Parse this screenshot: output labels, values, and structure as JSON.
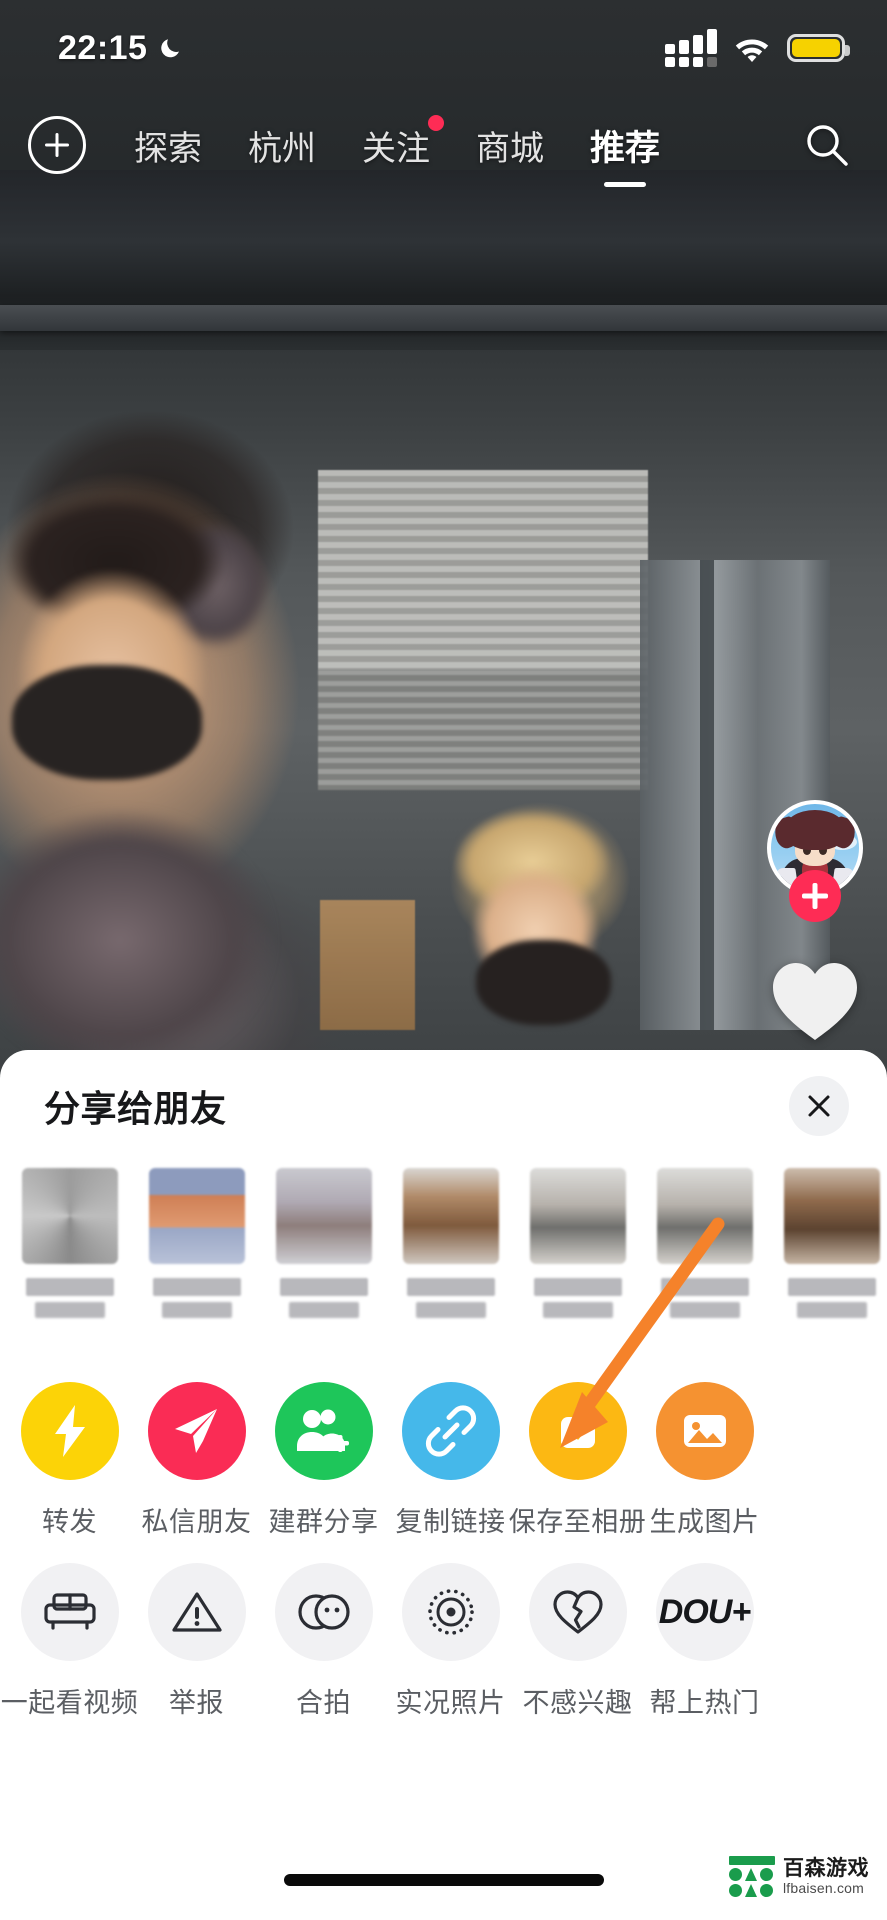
{
  "status_bar": {
    "time": "22:15",
    "moon_icon": "crescent-moon-icon",
    "signal_icon": "cellular-signal-icon",
    "wifi_icon": "wifi-icon",
    "battery_icon": "battery-icon",
    "battery_color": "#f6d200"
  },
  "top_nav": {
    "plus_icon": "plus-circle-icon",
    "search_icon": "search-icon",
    "tabs": [
      {
        "label": "探索",
        "active": false,
        "dot": false
      },
      {
        "label": "杭州",
        "active": false,
        "dot": false
      },
      {
        "label": "关注",
        "active": false,
        "dot": true
      },
      {
        "label": "商城",
        "active": false,
        "dot": false
      },
      {
        "label": "推荐",
        "active": true,
        "dot": false
      }
    ]
  },
  "right_rail": {
    "avatar_name": "user-avatar",
    "follow_label": "+",
    "like_icon": "heart-icon"
  },
  "share_sheet": {
    "title": "分享给朋友",
    "close_icon": "close-icon",
    "friends": [
      {
        "name": "",
        "censored": true
      },
      {
        "name": "",
        "censored": true
      },
      {
        "name": "",
        "censored": true
      },
      {
        "name": "",
        "censored": true
      },
      {
        "name": "",
        "censored": true
      },
      {
        "name": "",
        "censored": true
      },
      {
        "name": "",
        "censored": true
      }
    ],
    "actions_row1": [
      {
        "label": "转发",
        "icon": "lightning-bolt-icon",
        "color": "#fcd307",
        "style": "solid"
      },
      {
        "label": "私信朋友",
        "icon": "paper-plane-icon",
        "color": "#fa2c55",
        "style": "solid"
      },
      {
        "label": "建群分享",
        "icon": "add-group-icon",
        "color": "#1ec65a",
        "style": "solid"
      },
      {
        "label": "复制链接",
        "icon": "link-chain-icon",
        "color": "#45b8ea",
        "style": "solid"
      },
      {
        "label": "保存至相册",
        "icon": "download-album-icon",
        "color": "#fcb813",
        "style": "solid"
      },
      {
        "label": "生成图片",
        "icon": "image-picture-icon",
        "color": "#f59231",
        "style": "solid"
      }
    ],
    "actions_row2": [
      {
        "label": "一起看视频",
        "icon": "sofa-icon",
        "color": "#f1f1f3",
        "style": "grey"
      },
      {
        "label": "举报",
        "icon": "warning-triangle-icon",
        "color": "#f1f1f3",
        "style": "grey"
      },
      {
        "label": "合拍",
        "icon": "duet-circles-icon",
        "color": "#f1f1f3",
        "style": "grey"
      },
      {
        "label": "实况照片",
        "icon": "live-photo-icon",
        "color": "#f1f1f3",
        "style": "grey"
      },
      {
        "label": "不感兴趣",
        "icon": "broken-heart-icon",
        "color": "#f1f1f3",
        "style": "grey"
      },
      {
        "label": "帮上热门",
        "icon": "dou-plus-icon",
        "color": "#f1f1f3",
        "style": "grey",
        "icon_text": "DOU+"
      }
    ]
  },
  "annotation": {
    "arrow_icon": "orange-arrow-icon",
    "arrow_color": "#f5822a"
  },
  "watermark": {
    "cn": "百森游戏",
    "en": "lfbaisen.com"
  }
}
